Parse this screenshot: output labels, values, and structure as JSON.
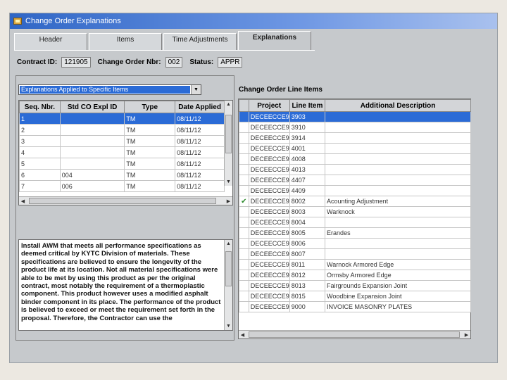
{
  "window": {
    "title": "Change Order Explanations",
    "title_icon": "app-icon"
  },
  "tabs": [
    {
      "label": "Header",
      "active": false
    },
    {
      "label": "Items",
      "active": false
    },
    {
      "label": "Time Adjustments",
      "active": false
    },
    {
      "label": "Explanations",
      "active": true
    }
  ],
  "info": {
    "contract_label": "Contract ID:",
    "contract_value": "121905",
    "co_label": "Change Order Nbr:",
    "co_value": "002",
    "status_label": "Status:",
    "status_value": "APPR"
  },
  "left": {
    "dropdown": {
      "value": "Explanations Applied to Specific Items"
    },
    "grid": {
      "columns": [
        "Seq. Nbr.",
        "Std CO Expl ID",
        "Type",
        "Date Applied"
      ],
      "rows": [
        [
          "1",
          "",
          "TM",
          "08/11/12"
        ],
        [
          "2",
          "",
          "TM",
          "08/11/12"
        ],
        [
          "3",
          "",
          "TM",
          "08/11/12"
        ],
        [
          "4",
          "",
          "TM",
          "08/11/12"
        ],
        [
          "5",
          "",
          "TM",
          "08/11/12"
        ],
        [
          "6",
          "004",
          "TM",
          "08/11/12"
        ],
        [
          "7",
          "006",
          "TM",
          "08/11/12"
        ]
      ],
      "selected_row": 0
    },
    "explanation": "Install AWM that meets all performance specifications as deemed critical by KYTC Division of materials.  These specifications are believed to ensure the longevity of the product life at its location.  Not all material specifications were able to be met by using this product as per the original contract, most notably the requirement of a thermoplastic component.  This product however uses a modified asphalt binder component in its place.  The performance of the product is believed to exceed or meet the requirement set forth in the proposal.  Therefore, the Contractor can use the"
  },
  "right": {
    "title": "Change Order Line Items",
    "columns": [
      "",
      "Project",
      "Line Item",
      "Additional Description"
    ],
    "rows": [
      {
        "checked": false,
        "project": "DECEECCE9",
        "line": "3903",
        "desc": ""
      },
      {
        "checked": false,
        "project": "DECEECCE9",
        "line": "3910",
        "desc": ""
      },
      {
        "checked": false,
        "project": "DECEECCE9",
        "line": "3914",
        "desc": ""
      },
      {
        "checked": false,
        "project": "DECEECCE9",
        "line": "4001",
        "desc": ""
      },
      {
        "checked": false,
        "project": "DECEECCE9",
        "line": "4008",
        "desc": ""
      },
      {
        "checked": false,
        "project": "DECEECCE9",
        "line": "4013",
        "desc": ""
      },
      {
        "checked": false,
        "project": "DECEECCE9",
        "line": "4407",
        "desc": ""
      },
      {
        "checked": false,
        "project": "DECEECCE9",
        "line": "4409",
        "desc": ""
      },
      {
        "checked": true,
        "project": "DECEECCE9",
        "line": "8002",
        "desc": "Acounting Adjustment"
      },
      {
        "checked": false,
        "project": "DECEECCE9",
        "line": "8003",
        "desc": "Warknock"
      },
      {
        "checked": false,
        "project": "DECEECCE9",
        "line": "8004",
        "desc": ""
      },
      {
        "checked": false,
        "project": "DECEECCE9",
        "line": "8005",
        "desc": "Erandes"
      },
      {
        "checked": false,
        "project": "DECEECCE9",
        "line": "8006",
        "desc": ""
      },
      {
        "checked": false,
        "project": "DECEECCE9",
        "line": "8007",
        "desc": ""
      },
      {
        "checked": false,
        "project": "DECEECCE9",
        "line": "8011",
        "desc": "Warnock Armored Edge"
      },
      {
        "checked": false,
        "project": "DECEECCE9",
        "line": "8012",
        "desc": "Ormsby Armored Edge"
      },
      {
        "checked": false,
        "project": "DECEECCE9",
        "line": "8013",
        "desc": "Fairgrounds Expansion Joint"
      },
      {
        "checked": false,
        "project": "DECEECCE9",
        "line": "8015",
        "desc": "Woodbine Expansion Joint"
      },
      {
        "checked": false,
        "project": "DECEECCE9",
        "line": "9000",
        "desc": "INVOICE MASONRY PLATES"
      }
    ],
    "selected_row": 0
  },
  "colors": {
    "selection": "#2b6bd6",
    "titlebar": "#2f66c6",
    "window": "#c6c9cc",
    "check": "#2d8a2d"
  },
  "icons": {
    "checkbox_checked": "checkmark-icon"
  }
}
